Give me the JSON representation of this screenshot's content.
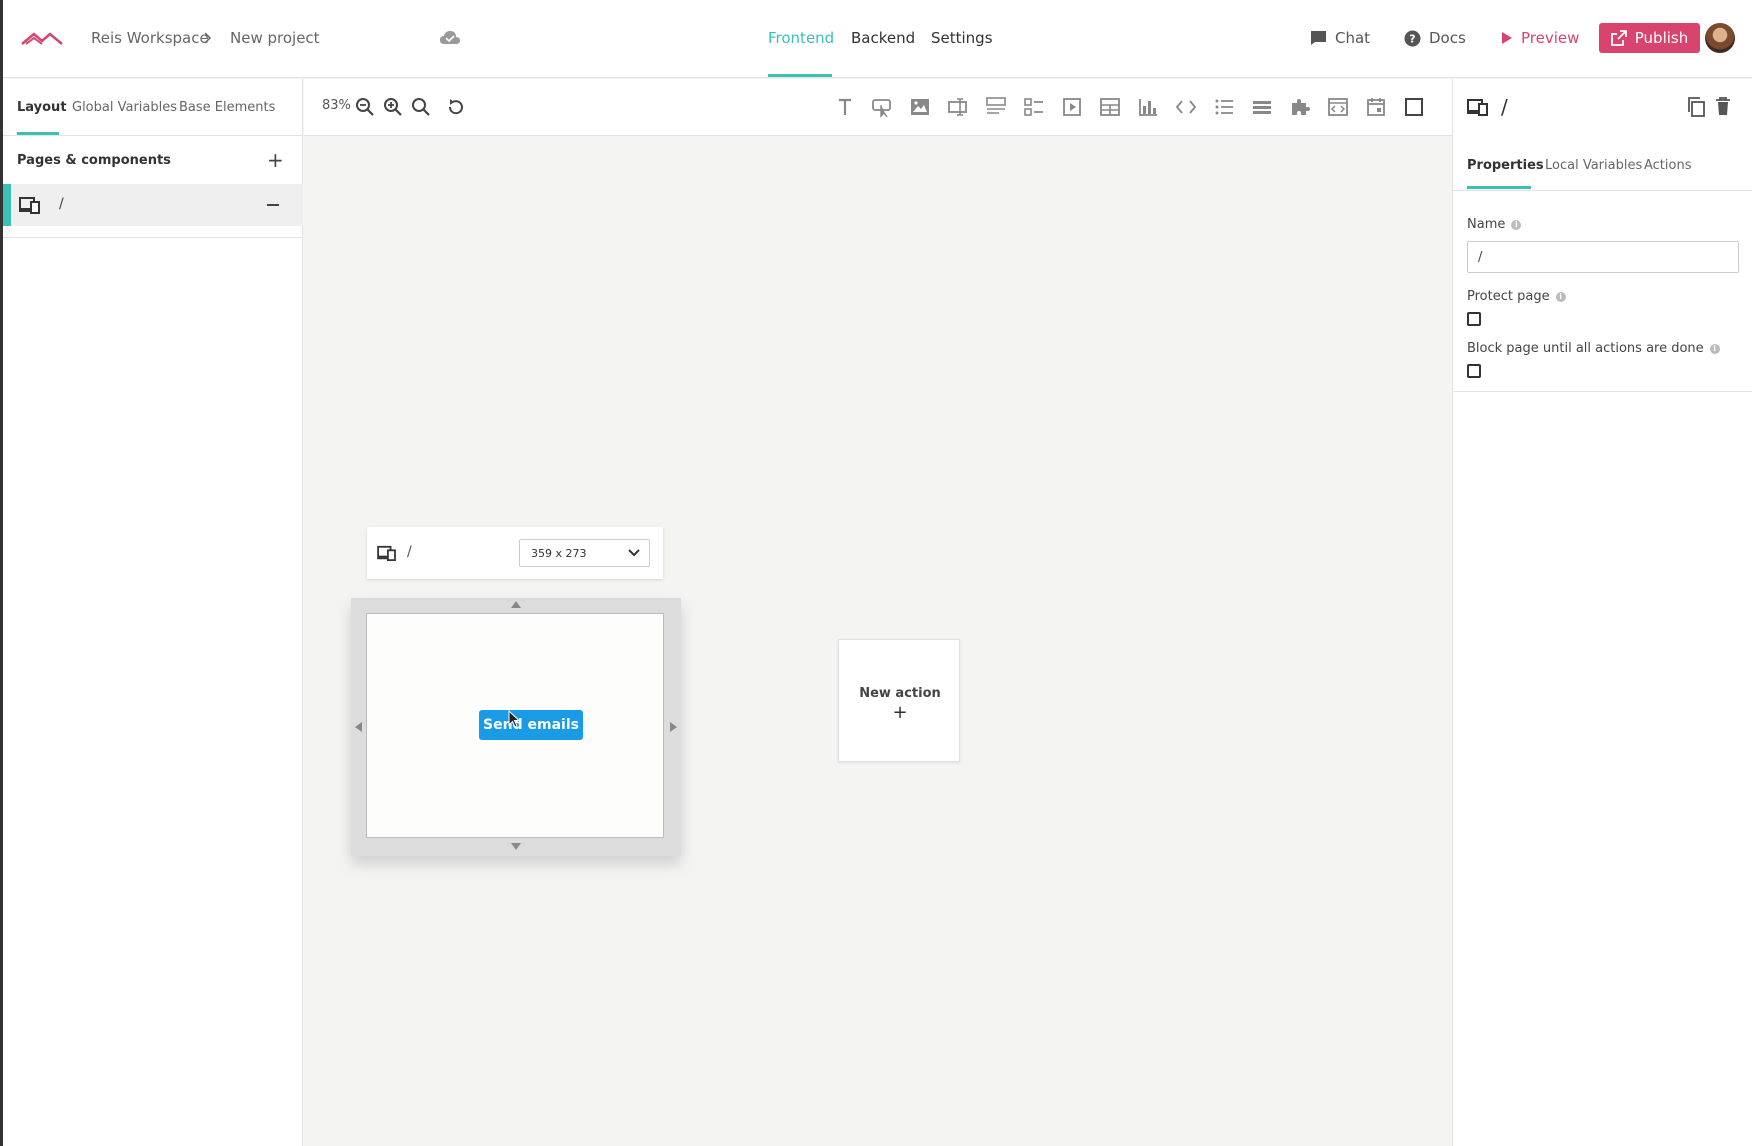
{
  "header": {
    "workspace": "Reis Workspace",
    "breadcrumb_sep": ">",
    "project": "New project",
    "nav": [
      {
        "label": "Frontend",
        "active": true
      },
      {
        "label": "Backend",
        "active": false
      },
      {
        "label": "Settings",
        "active": false
      }
    ],
    "chat_label": "Chat",
    "docs_label": "Docs",
    "preview_label": "Preview",
    "publish_label": "Publish",
    "brand_color": "#d8446e",
    "accent_color": "#3cbfb5"
  },
  "left_panel": {
    "tabs": [
      {
        "label": "Layout",
        "active": true
      },
      {
        "label": "Global Variables",
        "active": false
      },
      {
        "label": "Base Elements",
        "active": false
      }
    ],
    "section_title": "Pages & components",
    "add_symbol": "+",
    "pages": [
      {
        "label": "/",
        "icon": "devices-icon",
        "selected": true
      }
    ]
  },
  "toolbar": {
    "zoom": "83%",
    "zoom_icons": [
      "zoom-out-icon",
      "zoom-in-icon",
      "zoom-reset-icon",
      "reset-icon"
    ],
    "element_icons": [
      "text-icon",
      "button-icon",
      "image-icon",
      "input-icon",
      "form-icon",
      "checklist-icon",
      "video-icon",
      "table-icon",
      "chart-icon",
      "code-icon",
      "list-icon",
      "divider-icon",
      "plugin-icon",
      "embed-icon",
      "calendar-icon",
      "container-icon"
    ]
  },
  "canvas": {
    "page_name": "/",
    "size_value": "359 x 273",
    "button_label": "Send emails",
    "button_color": "#1a9be6",
    "new_action_label": "New action",
    "new_action_plus": "+"
  },
  "right_panel": {
    "title": "/",
    "tabs": [
      {
        "label": "Properties",
        "active": true
      },
      {
        "label": "Local Variables",
        "active": false
      },
      {
        "label": "Actions",
        "active": false
      }
    ],
    "name_label": "Name",
    "name_value": "/",
    "protect_label": "Protect page",
    "protect_checked": false,
    "block_label": "Block page until all actions are done",
    "block_checked": false,
    "info_symbol": "i"
  }
}
